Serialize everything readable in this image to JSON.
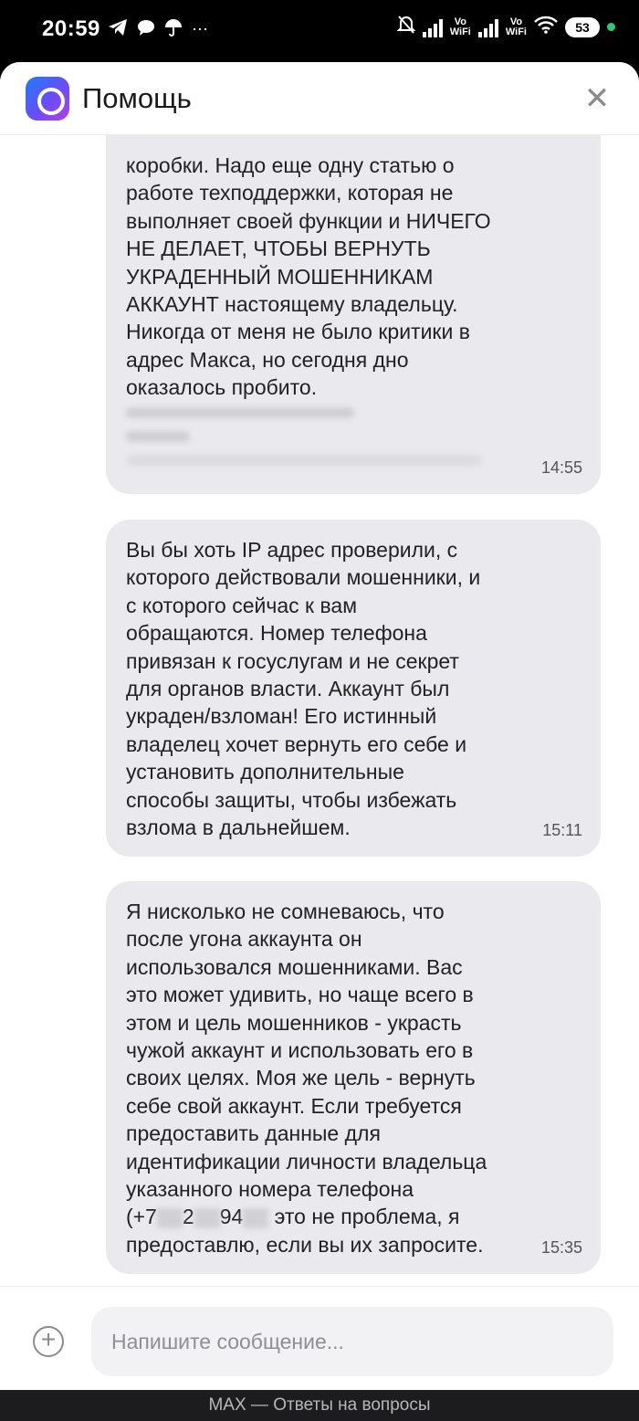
{
  "status_bar": {
    "time": "20:59",
    "left_icons": [
      "telegram-icon",
      "chat-icon",
      "umbrella-icon",
      "more-icon"
    ],
    "vowifi_1": "Vo\nWiFi",
    "vowifi_2": "Vo\nWiFi",
    "battery": "53"
  },
  "header": {
    "title": "Помощь"
  },
  "messages": [
    {
      "text": "коробки. Надо еще одну статью о\nработе техподдержки, которая не\nвыполняет своей функции и НИЧЕГО\nНЕ ДЕЛАЕТ, ЧТОБЫ ВЕРНУТЬ\nУКРАДЕННЫЙ МОШЕННИКАМ\nАККАУНТ настоящему владельцу.\nНикогда от меня не было критики в\nадрес Макса, но сегодня дно\nоказалось пробито.",
      "time": "14:55"
    },
    {
      "text": "Вы бы хоть IP адрес проверили, с\nкоторого действовали мошенники, и\nс которого сейчас к вам\nобращаются. Номер телефона\nпривязан к госуслугам и не секрет\nдля органов власти. Аккаунт был\nукраден/взломан! Его истинный\nвладелец хочет вернуть его себе и\nустановить дополнительные\nспособы защиты, чтобы избежать\nвзлома в дальнейшем.",
      "time": "15:11"
    },
    {
      "text_a": "Я нисколько не сомневаюсь, что\nпосле угона аккаунта он\nиспользовался мошенниками. Вас\nэто может удивить, но чаще всего в\nэтом и цель мошенников - украсть\nчужой аккаунт и использовать его в\nсвоих целях. Моя же цель - вернуть\nсебе свой аккаунт. Если требуется\nпредоставить данные для\nидентификации личности владельца\nуказанного номера телефона\n",
      "phone_parts": [
        "(+7",
        "2",
        "94"
      ],
      "text_b": " это не проблема, я\nпредоставлю, если вы их запросите.",
      "time": "15:35"
    }
  ],
  "input": {
    "placeholder": "Напишите сообщение..."
  },
  "footer": {
    "text": "MAX — Ответы на вопросы"
  }
}
